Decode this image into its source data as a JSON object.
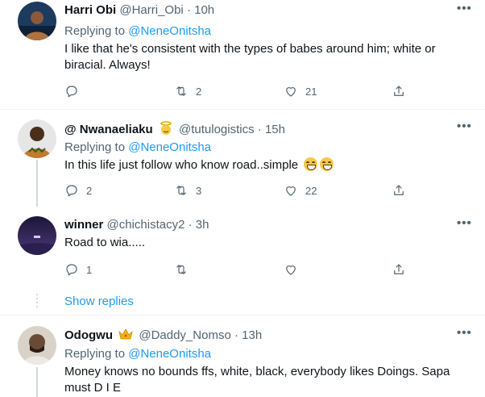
{
  "colors": {
    "link": "#1d9bf0",
    "muted": "#536471",
    "text": "#0f1419",
    "divider": "#eff3f4"
  },
  "tweets": [
    {
      "name": "Harri Obi",
      "handle": "@Harri_Obi",
      "sep": "·",
      "time": "10h",
      "replying_prefix": "Replying to ",
      "replying_to": "@NeneOnitsha",
      "text": "I like that he's consistent with the types of babes around him; white or biracial. Always!",
      "reply_count": "",
      "retweet_count": "2",
      "like_count": "21"
    },
    {
      "name": "@ Nwanaeliaku",
      "handle": "@tutulogistics",
      "sep": "·",
      "time": "15h",
      "replying_prefix": "Replying to ",
      "replying_to": "@NeneOnitsha",
      "text": "In this life just follow who know road..simple",
      "reply_count": "2",
      "retweet_count": "3",
      "like_count": "22"
    },
    {
      "name": "winner",
      "handle": "@chichistacy2",
      "sep": "·",
      "time": "3h",
      "text": "Road to wia.....",
      "reply_count": "1",
      "retweet_count": "",
      "like_count": ""
    },
    {
      "name": "Odogwu",
      "handle": "@Daddy_Nomso",
      "sep": "·",
      "time": "13h",
      "replying_prefix": "Replying to ",
      "replying_to": "@NeneOnitsha",
      "text_line1": "Money knows no bounds ffs, white, black, everybody likes Doings. Sapa",
      "text_line2": "must D I E"
    }
  ],
  "more_label": "•••",
  "show_replies": "Show replies",
  "icons": [
    "reply-icon",
    "retweet-icon",
    "like-icon",
    "share-icon",
    "more-icon",
    "crown-icon",
    "halo-emoji-icon",
    "grin-emoji-icon"
  ]
}
